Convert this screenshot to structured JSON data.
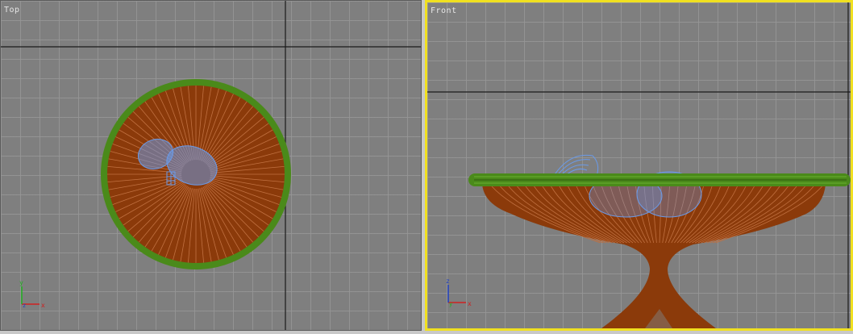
{
  "viewports": {
    "top": {
      "label": "Top"
    },
    "front": {
      "label": "Front"
    }
  },
  "axis_labels": {
    "x": "x",
    "y": "y",
    "z": "z"
  },
  "colors": {
    "viewport_bg": "#7f7f7f",
    "grid": "#969696",
    "home_grid_axis": "#1a1a1a",
    "active_border": "#f0e020",
    "rim_green": "#4a8a1a",
    "slats_brown": "#8b3a0a",
    "fruit_blue": "#6a9ae8"
  },
  "icons": [
    "axis-tripod-icon"
  ]
}
